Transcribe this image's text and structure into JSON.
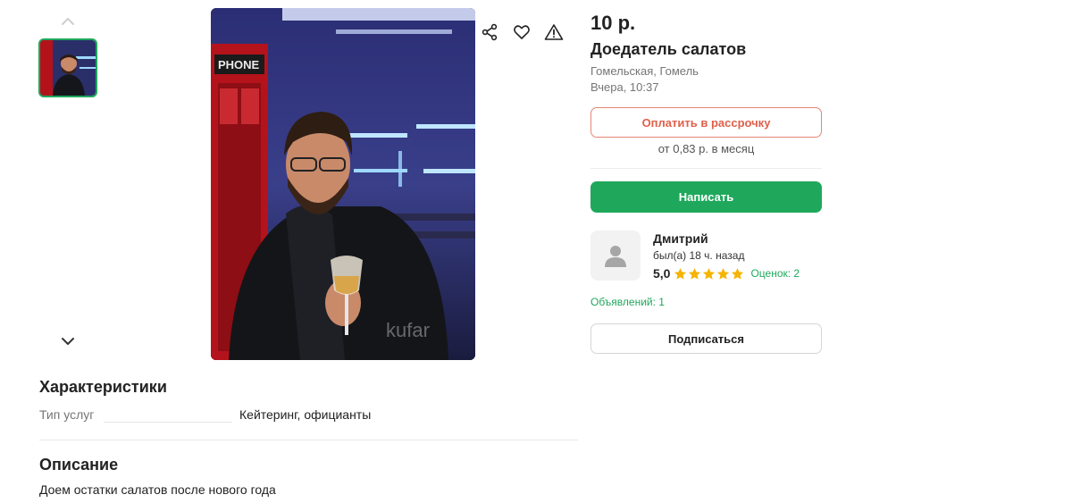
{
  "gallery": {
    "nav_up_icon": "chevron-up-icon",
    "nav_down_icon": "chevron-down-icon",
    "watermark": "kufar",
    "sign_text": "PHONE"
  },
  "actions": {
    "share_icon": "share-icon",
    "favorite_icon": "heart-icon",
    "report_icon": "warning-icon"
  },
  "listing": {
    "price": "10 р.",
    "title": "Доедатель салатов",
    "location": "Гомельская, Гомель",
    "date": "Вчера, 10:37",
    "installment_button": "Оплатить в рассрочку",
    "installment_note": "от 0,83 р. в месяц",
    "write_button": "Написать"
  },
  "seller": {
    "name": "Дмитрий",
    "status": "был(а) 18 ч. назад",
    "rating": "5,0",
    "stars": 5,
    "reviews": "Оценок: 2",
    "ads": "Объявлений: 1",
    "subscribe_button": "Подписаться"
  },
  "characteristics": {
    "title": "Характеристики",
    "rows": [
      {
        "label": "Тип услуг",
        "value": "Кейтеринг, официанты"
      }
    ]
  },
  "description": {
    "title": "Описание",
    "text": "Доем остатки салатов после нового года"
  },
  "colors": {
    "accent_green": "#1fa85c",
    "installment_red": "#e0604a",
    "star_yellow": "#f5b400"
  }
}
